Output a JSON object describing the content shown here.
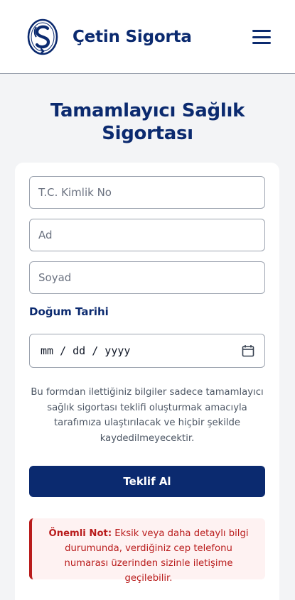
{
  "header": {
    "brand": "Çetin Sigorta",
    "logo_icon": "cetin-sigorta-logo",
    "menu_icon": "hamburger-menu-icon"
  },
  "page": {
    "title": "Tamamlayıcı Sağlık Sigortası"
  },
  "form": {
    "tc_placeholder": "T.C. Kimlik No",
    "tc_value": "",
    "name_placeholder": "Ad",
    "name_value": "",
    "surname_placeholder": "Soyad",
    "surname_value": "",
    "dob_label": "Doğum Tarihi",
    "dob_display": "mm / dd / yyyy",
    "disclaimer": "Bu formdan ilettiğiniz bilgiler sadece tamamlayıcı sağlık sigortası teklifi oluşturmak amacıyla tarafımıza ulaştırılacak ve hiçbir şekilde kaydedilmeyecektir.",
    "submit_label": "Teklif Al"
  },
  "note": {
    "title": "Önemli Not:",
    "text": " Eksik veya daha detaylı bilgi durumunda, verdiğiniz cep telefonu numarası üzerinden sizinle iletişime geçilebilir."
  },
  "colors": {
    "brand": "#0b2a6f",
    "background": "#f3f4f6",
    "note_text": "#b91c1c",
    "note_bg": "#fef2f2"
  }
}
